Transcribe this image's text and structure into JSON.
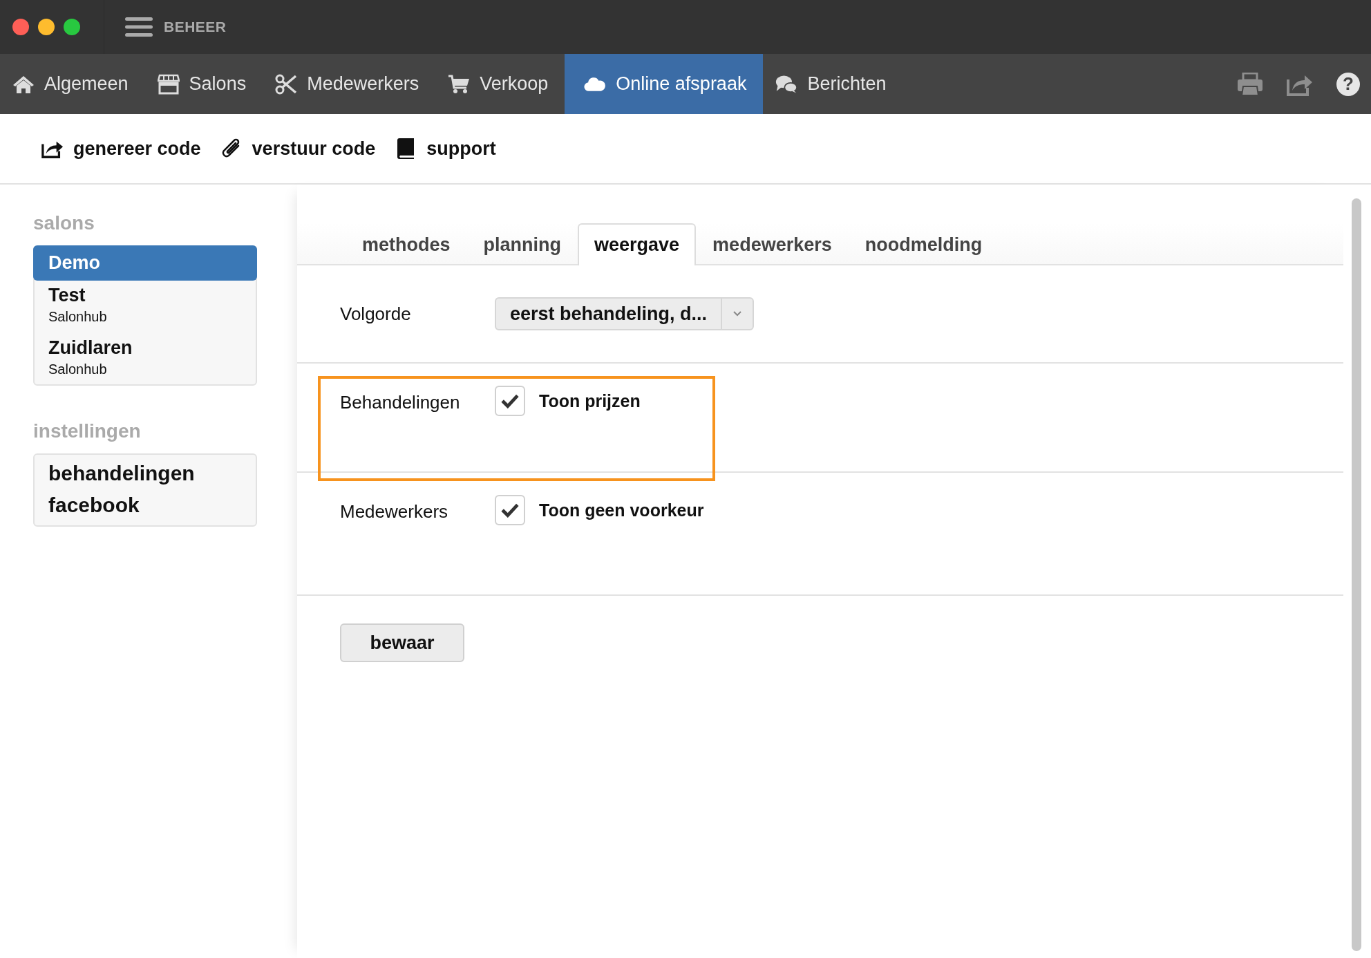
{
  "window": {
    "title": "BEHEER"
  },
  "nav": [
    {
      "label": "Algemeen",
      "selected": false
    },
    {
      "label": "Salons",
      "selected": false
    },
    {
      "label": "Medewerkers",
      "selected": false
    },
    {
      "label": "Verkoop",
      "selected": false
    },
    {
      "label": "Online afspraak",
      "selected": true
    },
    {
      "label": "Berichten",
      "selected": false
    }
  ],
  "help": "?",
  "toolbar": [
    {
      "label": "genereer code"
    },
    {
      "label": "verstuur code"
    },
    {
      "label": "support"
    }
  ],
  "sidebar": {
    "salons_heading": "salons",
    "salons": [
      {
        "name": "Demo",
        "selected": true
      },
      {
        "name": "Test",
        "sub": "Salonhub",
        "selected": false
      },
      {
        "name": "Zuidlaren",
        "sub": "Salonhub",
        "selected": false
      }
    ],
    "settings_heading": "instellingen",
    "settings": [
      "behandelingen",
      "facebook"
    ]
  },
  "tabs": [
    {
      "label": "methodes",
      "selected": false
    },
    {
      "label": "planning",
      "selected": false
    },
    {
      "label": "weergave",
      "selected": true
    },
    {
      "label": "medewerkers",
      "selected": false
    },
    {
      "label": "noodmelding",
      "selected": false
    }
  ],
  "rows": [
    {
      "kind": "select",
      "label": "Volgorde",
      "value": "eerst behandeling, d...",
      "highlight": false
    },
    {
      "kind": "checkbox",
      "label": "Behandelingen",
      "option": "Toon prijzen",
      "checked": true,
      "highlight": true
    },
    {
      "kind": "checkbox",
      "label": "Medewerkers",
      "option": "Toon geen voorkeur",
      "checked": true,
      "highlight": false
    }
  ],
  "save_button": "bewaar"
}
